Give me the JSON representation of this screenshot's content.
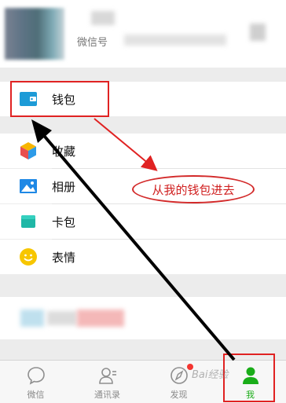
{
  "profile": {
    "wechat_id_label": "微信号"
  },
  "menu": {
    "wallet": "钱包",
    "favorites": "收藏",
    "album": "相册",
    "cards": "卡包",
    "stickers": "表情"
  },
  "tabs": [
    {
      "label": "微信",
      "icon": "chat-bubble-icon",
      "active": false
    },
    {
      "label": "通讯录",
      "icon": "contacts-icon",
      "active": false
    },
    {
      "label": "发现",
      "icon": "compass-icon",
      "active": false,
      "badge": true
    },
    {
      "label": "我",
      "icon": "person-icon",
      "active": true
    }
  ],
  "annotation": {
    "callout_text": "从我的钱包进去"
  },
  "colors": {
    "active_tab": "#1aad19",
    "annotation_red": "#e02222",
    "badge_red": "#f43530"
  }
}
